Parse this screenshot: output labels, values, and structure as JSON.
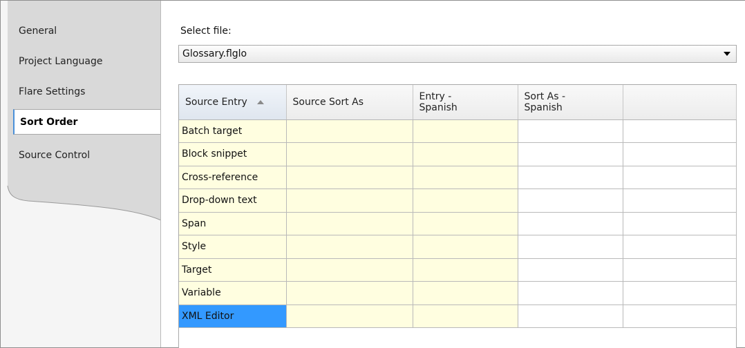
{
  "nav": {
    "items": [
      {
        "label": "General",
        "selected": false
      },
      {
        "label": "Project Language",
        "selected": false
      },
      {
        "label": "Flare Settings",
        "selected": false
      },
      {
        "label": "Sort Order",
        "selected": true
      },
      {
        "label": "Source Control",
        "selected": false
      }
    ]
  },
  "main": {
    "select_label": "Select file:",
    "file_value": "Glossary.flglo",
    "dropdown_icon": "chevron-down-icon"
  },
  "grid": {
    "columns": [
      {
        "label": "Source Entry",
        "sorted": "ascending",
        "sort_icon": "sort-ascending-icon"
      },
      {
        "label": "Source Sort As"
      },
      {
        "label": "Entry -\nSpanish"
      },
      {
        "label": "Sort As -\nSpanish"
      },
      {
        "label": ""
      }
    ],
    "rows": [
      {
        "entry": "Batch target",
        "selected": false
      },
      {
        "entry": "Block snippet",
        "selected": false
      },
      {
        "entry": "Cross-reference",
        "selected": false
      },
      {
        "entry": "Drop-down text",
        "selected": false
      },
      {
        "entry": "Span",
        "selected": false
      },
      {
        "entry": "Style",
        "selected": false
      },
      {
        "entry": "Target",
        "selected": false
      },
      {
        "entry": "Variable",
        "selected": false
      },
      {
        "entry": "XML Editor",
        "selected": true
      }
    ],
    "colors": {
      "editable_cell": "#fffee0",
      "selected_cell": "#3399ff",
      "nav_selected_accent": "#4a90d9"
    }
  }
}
